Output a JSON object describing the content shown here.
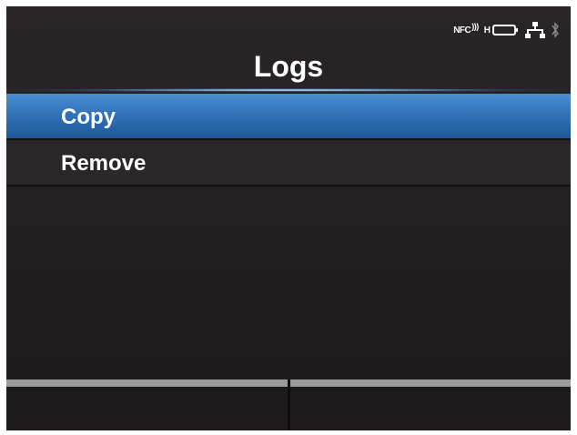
{
  "status_icons": [
    "nfc-icon",
    "sd-card-icon",
    "battery-icon",
    "network-icon",
    "bluetooth-icon"
  ],
  "nfc_label": "NFC",
  "sd_label": "H",
  "title": "Logs",
  "menu": {
    "items": [
      {
        "label": "Copy",
        "selected": true
      },
      {
        "label": "Remove",
        "selected": false
      }
    ]
  },
  "softkeys": [
    "",
    ""
  ],
  "colors": {
    "background": "#242022",
    "selected": "#2f70b6",
    "softkey_bar": "#9a9a9c",
    "text": "#ffffff"
  }
}
